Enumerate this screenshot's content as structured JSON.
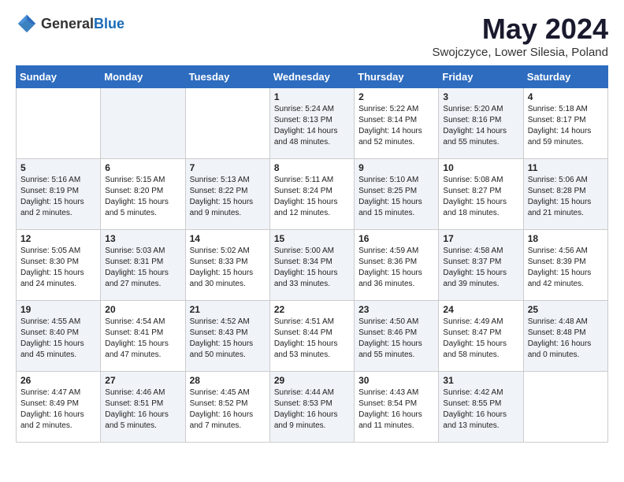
{
  "header": {
    "logo_general": "General",
    "logo_blue": "Blue",
    "title": "May 2024",
    "subtitle": "Swojczyce, Lower Silesia, Poland"
  },
  "days_of_week": [
    "Sunday",
    "Monday",
    "Tuesday",
    "Wednesday",
    "Thursday",
    "Friday",
    "Saturday"
  ],
  "weeks": [
    [
      {
        "day": "",
        "info": ""
      },
      {
        "day": "",
        "info": ""
      },
      {
        "day": "",
        "info": ""
      },
      {
        "day": "1",
        "info": "Sunrise: 5:24 AM\nSunset: 8:13 PM\nDaylight: 14 hours\nand 48 minutes."
      },
      {
        "day": "2",
        "info": "Sunrise: 5:22 AM\nSunset: 8:14 PM\nDaylight: 14 hours\nand 52 minutes."
      },
      {
        "day": "3",
        "info": "Sunrise: 5:20 AM\nSunset: 8:16 PM\nDaylight: 14 hours\nand 55 minutes."
      },
      {
        "day": "4",
        "info": "Sunrise: 5:18 AM\nSunset: 8:17 PM\nDaylight: 14 hours\nand 59 minutes."
      }
    ],
    [
      {
        "day": "5",
        "info": "Sunrise: 5:16 AM\nSunset: 8:19 PM\nDaylight: 15 hours\nand 2 minutes."
      },
      {
        "day": "6",
        "info": "Sunrise: 5:15 AM\nSunset: 8:20 PM\nDaylight: 15 hours\nand 5 minutes."
      },
      {
        "day": "7",
        "info": "Sunrise: 5:13 AM\nSunset: 8:22 PM\nDaylight: 15 hours\nand 9 minutes."
      },
      {
        "day": "8",
        "info": "Sunrise: 5:11 AM\nSunset: 8:24 PM\nDaylight: 15 hours\nand 12 minutes."
      },
      {
        "day": "9",
        "info": "Sunrise: 5:10 AM\nSunset: 8:25 PM\nDaylight: 15 hours\nand 15 minutes."
      },
      {
        "day": "10",
        "info": "Sunrise: 5:08 AM\nSunset: 8:27 PM\nDaylight: 15 hours\nand 18 minutes."
      },
      {
        "day": "11",
        "info": "Sunrise: 5:06 AM\nSunset: 8:28 PM\nDaylight: 15 hours\nand 21 minutes."
      }
    ],
    [
      {
        "day": "12",
        "info": "Sunrise: 5:05 AM\nSunset: 8:30 PM\nDaylight: 15 hours\nand 24 minutes."
      },
      {
        "day": "13",
        "info": "Sunrise: 5:03 AM\nSunset: 8:31 PM\nDaylight: 15 hours\nand 27 minutes."
      },
      {
        "day": "14",
        "info": "Sunrise: 5:02 AM\nSunset: 8:33 PM\nDaylight: 15 hours\nand 30 minutes."
      },
      {
        "day": "15",
        "info": "Sunrise: 5:00 AM\nSunset: 8:34 PM\nDaylight: 15 hours\nand 33 minutes."
      },
      {
        "day": "16",
        "info": "Sunrise: 4:59 AM\nSunset: 8:36 PM\nDaylight: 15 hours\nand 36 minutes."
      },
      {
        "day": "17",
        "info": "Sunrise: 4:58 AM\nSunset: 8:37 PM\nDaylight: 15 hours\nand 39 minutes."
      },
      {
        "day": "18",
        "info": "Sunrise: 4:56 AM\nSunset: 8:39 PM\nDaylight: 15 hours\nand 42 minutes."
      }
    ],
    [
      {
        "day": "19",
        "info": "Sunrise: 4:55 AM\nSunset: 8:40 PM\nDaylight: 15 hours\nand 45 minutes."
      },
      {
        "day": "20",
        "info": "Sunrise: 4:54 AM\nSunset: 8:41 PM\nDaylight: 15 hours\nand 47 minutes."
      },
      {
        "day": "21",
        "info": "Sunrise: 4:52 AM\nSunset: 8:43 PM\nDaylight: 15 hours\nand 50 minutes."
      },
      {
        "day": "22",
        "info": "Sunrise: 4:51 AM\nSunset: 8:44 PM\nDaylight: 15 hours\nand 53 minutes."
      },
      {
        "day": "23",
        "info": "Sunrise: 4:50 AM\nSunset: 8:46 PM\nDaylight: 15 hours\nand 55 minutes."
      },
      {
        "day": "24",
        "info": "Sunrise: 4:49 AM\nSunset: 8:47 PM\nDaylight: 15 hours\nand 58 minutes."
      },
      {
        "day": "25",
        "info": "Sunrise: 4:48 AM\nSunset: 8:48 PM\nDaylight: 16 hours\nand 0 minutes."
      }
    ],
    [
      {
        "day": "26",
        "info": "Sunrise: 4:47 AM\nSunset: 8:49 PM\nDaylight: 16 hours\nand 2 minutes."
      },
      {
        "day": "27",
        "info": "Sunrise: 4:46 AM\nSunset: 8:51 PM\nDaylight: 16 hours\nand 5 minutes."
      },
      {
        "day": "28",
        "info": "Sunrise: 4:45 AM\nSunset: 8:52 PM\nDaylight: 16 hours\nand 7 minutes."
      },
      {
        "day": "29",
        "info": "Sunrise: 4:44 AM\nSunset: 8:53 PM\nDaylight: 16 hours\nand 9 minutes."
      },
      {
        "day": "30",
        "info": "Sunrise: 4:43 AM\nSunset: 8:54 PM\nDaylight: 16 hours\nand 11 minutes."
      },
      {
        "day": "31",
        "info": "Sunrise: 4:42 AM\nSunset: 8:55 PM\nDaylight: 16 hours\nand 13 minutes."
      },
      {
        "day": "",
        "info": ""
      }
    ]
  ]
}
